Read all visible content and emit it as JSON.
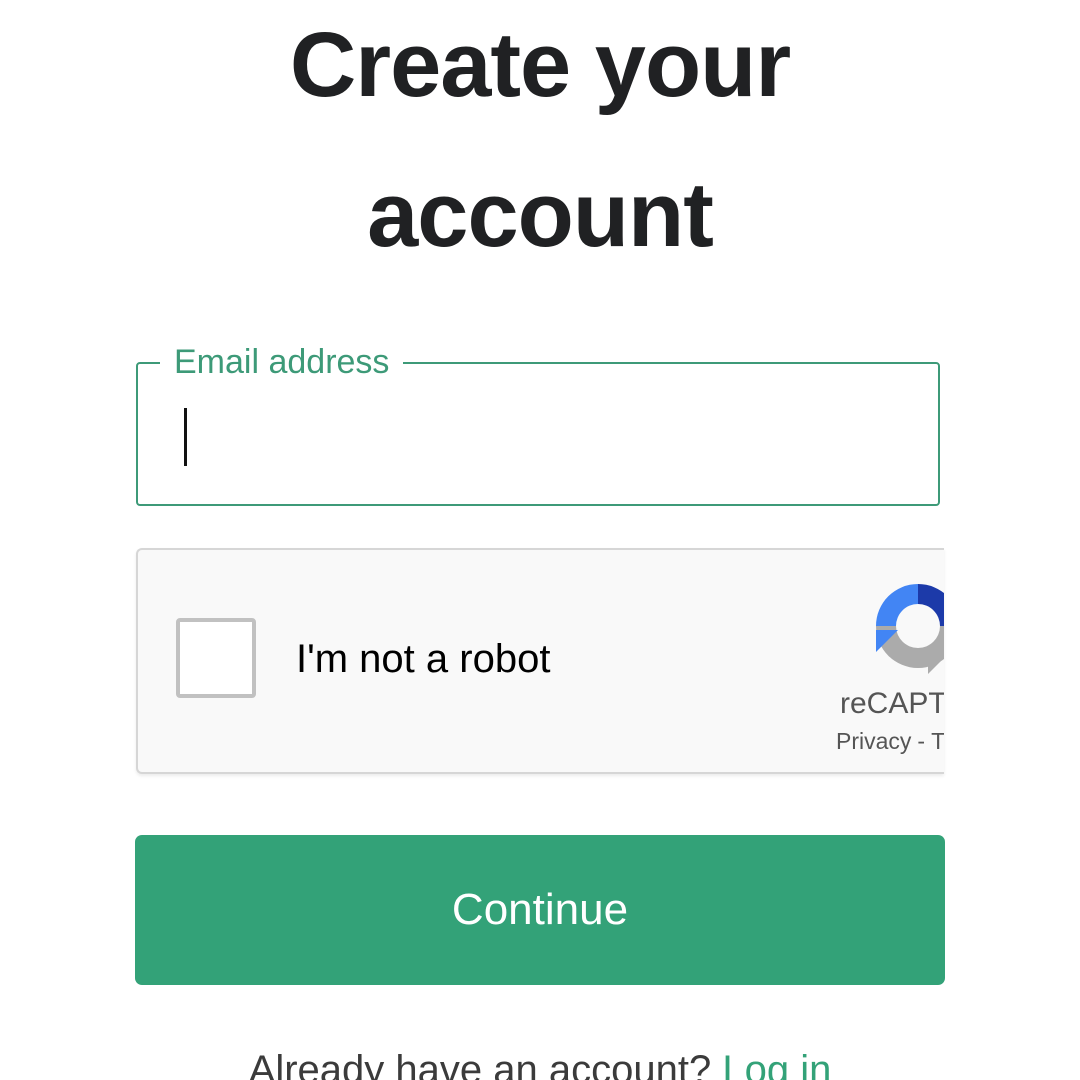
{
  "heading": {
    "line1": "Create your",
    "line2": "account"
  },
  "email": {
    "label": "Email address",
    "value": "",
    "placeholder": ""
  },
  "recaptcha": {
    "checkbox_label": "I'm not a robot",
    "checked": false,
    "brand": "reCAPT",
    "privacy": "Privacy",
    "separator": "-",
    "terms": "T",
    "icon": "recaptcha-logo-icon"
  },
  "continue_button": {
    "label": "Continue"
  },
  "footer": {
    "prompt": "Already have an account?",
    "login_link": "Log in"
  },
  "colors": {
    "accent": "#33a278",
    "accent_outline": "#3d9a78",
    "heading": "#202123",
    "recaptcha_bg": "#f9f9f9",
    "recaptcha_blue": "#1c3aa9",
    "recaptcha_light_blue": "#4285f4",
    "recaptcha_gray": "#ababab"
  }
}
